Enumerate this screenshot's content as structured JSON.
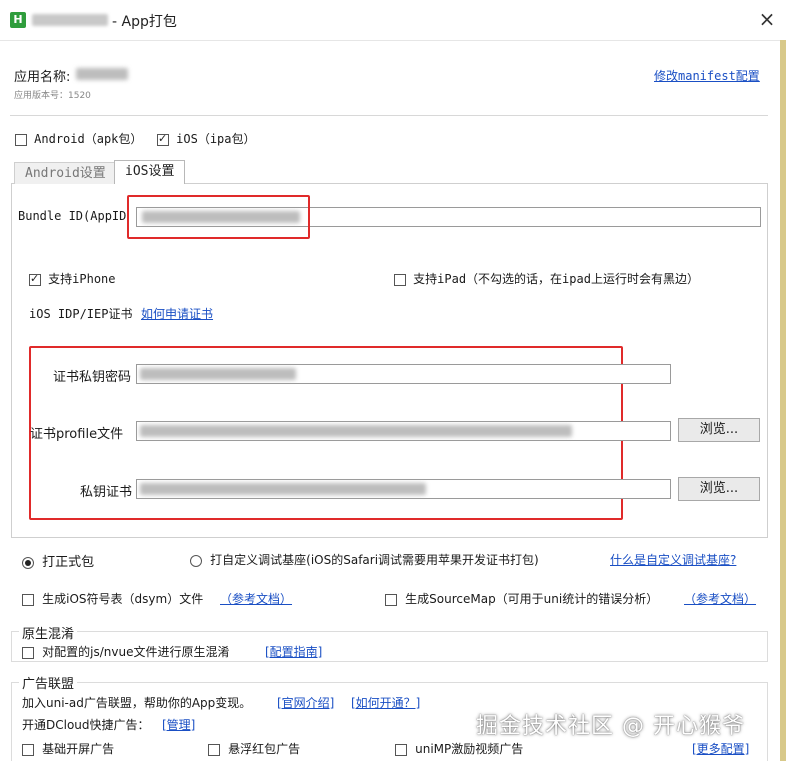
{
  "window": {
    "logo_letter": "H",
    "title": "- App打包"
  },
  "app": {
    "name_label": "应用名称:",
    "version_label": "应用版本号：1520",
    "edit_manifest": "修改manifest配置"
  },
  "platforms": {
    "android": "Android（apk包）",
    "ios": "iOS（ipa包）",
    "android_checked": false,
    "ios_checked": true
  },
  "tabs": [
    {
      "label": "Android设置",
      "active": false
    },
    {
      "label": "iOS设置",
      "active": true
    }
  ],
  "ios": {
    "bundle_id_label": "Bundle ID(AppID",
    "support_iphone": "支持iPhone",
    "support_iphone_checked": true,
    "support_ipad": "支持iPad（不勾选的话，在ipad上运行时会有黑边）",
    "support_ipad_checked": false,
    "cert_label": "iOS IDP/IEP证书",
    "how_apply_link": "如何申请证书",
    "private_key_password_label": "证书私钥密码",
    "profile_label": "证书profile文件",
    "private_cert_label": "私钥证书",
    "browse_button": "浏览..."
  },
  "build": {
    "formal": "打正式包",
    "formal_selected": true,
    "custom_base": "打自定义调试基座(iOS的Safari调试需要用苹果开发证书打包)",
    "custom_base_selected": false,
    "what_is_custom_base": "什么是自定义调试基座?"
  },
  "options": {
    "dsym": "生成iOS符号表（dsym）文件",
    "dsym_ref": "（参考文档）",
    "sourcemap": "生成SourceMap（可用于uni统计的错误分析）",
    "sourcemap_ref": "（参考文档）"
  },
  "obfuscation": {
    "group_title": "原生混淆",
    "option": "对配置的js/nvue文件进行原生混淆",
    "guide_link": "[配置指南]"
  },
  "ads": {
    "group_title": "广告联盟",
    "intro": "加入uni-ad广告联盟，帮助你的App变现。",
    "official_link": "[官网介绍]",
    "how_open_link": "[如何开通？]",
    "dcloud_label": "开通DCloud快捷广告：",
    "manage_link": "[管理]",
    "splash": "基础开屏广告",
    "redpacket": "悬浮红包广告",
    "unimp_video": "uniMP激励视频广告",
    "more_config": "[更多配置]"
  },
  "watermark": "掘金技术社区 @ 开心猴爷",
  "colors": {
    "link": "#1a4fc4",
    "highlight_box": "#e02a2a",
    "logo": "#2f9d3c"
  }
}
